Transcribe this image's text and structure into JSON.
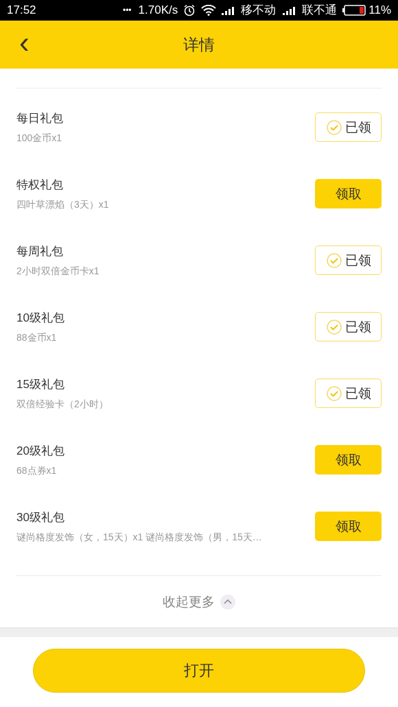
{
  "status_bar": {
    "time": "17:52",
    "dots": "•••",
    "speed": "1.70K/s",
    "carrier_1": "移不动",
    "carrier_2": "联不通",
    "battery": "11%"
  },
  "header": {
    "back": "‹",
    "title": "详情"
  },
  "gifts": [
    {
      "title": "每日礼包",
      "detail": "100金币x1",
      "claimed": true,
      "button": "已领"
    },
    {
      "title": "特权礼包",
      "detail": "四叶草漂焰（3天）x1",
      "claimed": false,
      "button": "领取"
    },
    {
      "title": "每周礼包",
      "detail": "2小时双倍金币卡x1",
      "claimed": true,
      "button": "已领"
    },
    {
      "title": "10级礼包",
      "detail": "88金币x1",
      "claimed": true,
      "button": "已领"
    },
    {
      "title": "15级礼包",
      "detail": "双倍经验卡（2小时）",
      "claimed": true,
      "button": "已领"
    },
    {
      "title": "20级礼包",
      "detail": "68点券x1",
      "claimed": false,
      "button": "领取"
    },
    {
      "title": "30级礼包",
      "detail": "谜尚格度发饰（女，15天）x1 谜尚格度发饰（男，15天…",
      "claimed": false,
      "button": "领取"
    }
  ],
  "collapse": {
    "label": "收起更多"
  },
  "footer": {
    "button": "打开"
  }
}
